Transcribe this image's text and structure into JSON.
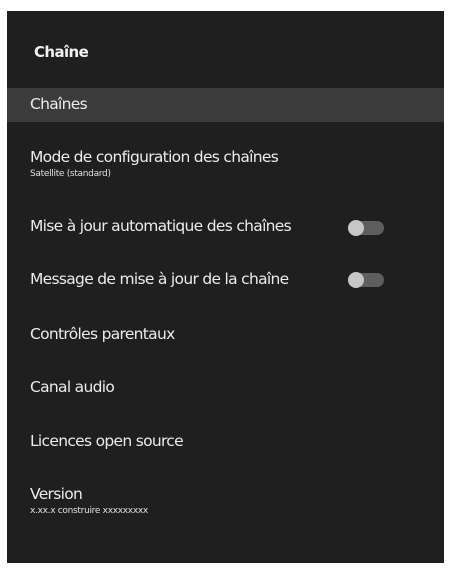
{
  "panel": {
    "title": "Chaîne"
  },
  "items": [
    {
      "label": "Chaînes",
      "selected": true
    },
    {
      "label": "Mode de configuration des chaînes",
      "sub": "Satellite (standard)"
    },
    {
      "label": "Mise à jour automatique des chaînes",
      "toggle": "off"
    },
    {
      "label": "Message de mise à jour de la chaîne",
      "toggle": "off"
    },
    {
      "label": "Contrôles parentaux"
    },
    {
      "label": "Canal audio"
    },
    {
      "label": "Licences open source"
    },
    {
      "label": "Version",
      "sub": "x.xx.x construire xxxxxxxxx"
    }
  ],
  "colors": {
    "panel_bg": "#1f1f1f",
    "selected_bg": "#3b3b3b",
    "text": "#ececec",
    "toggle_track_off": "#5e5e5e",
    "toggle_knob_off": "#c7c7c7"
  }
}
